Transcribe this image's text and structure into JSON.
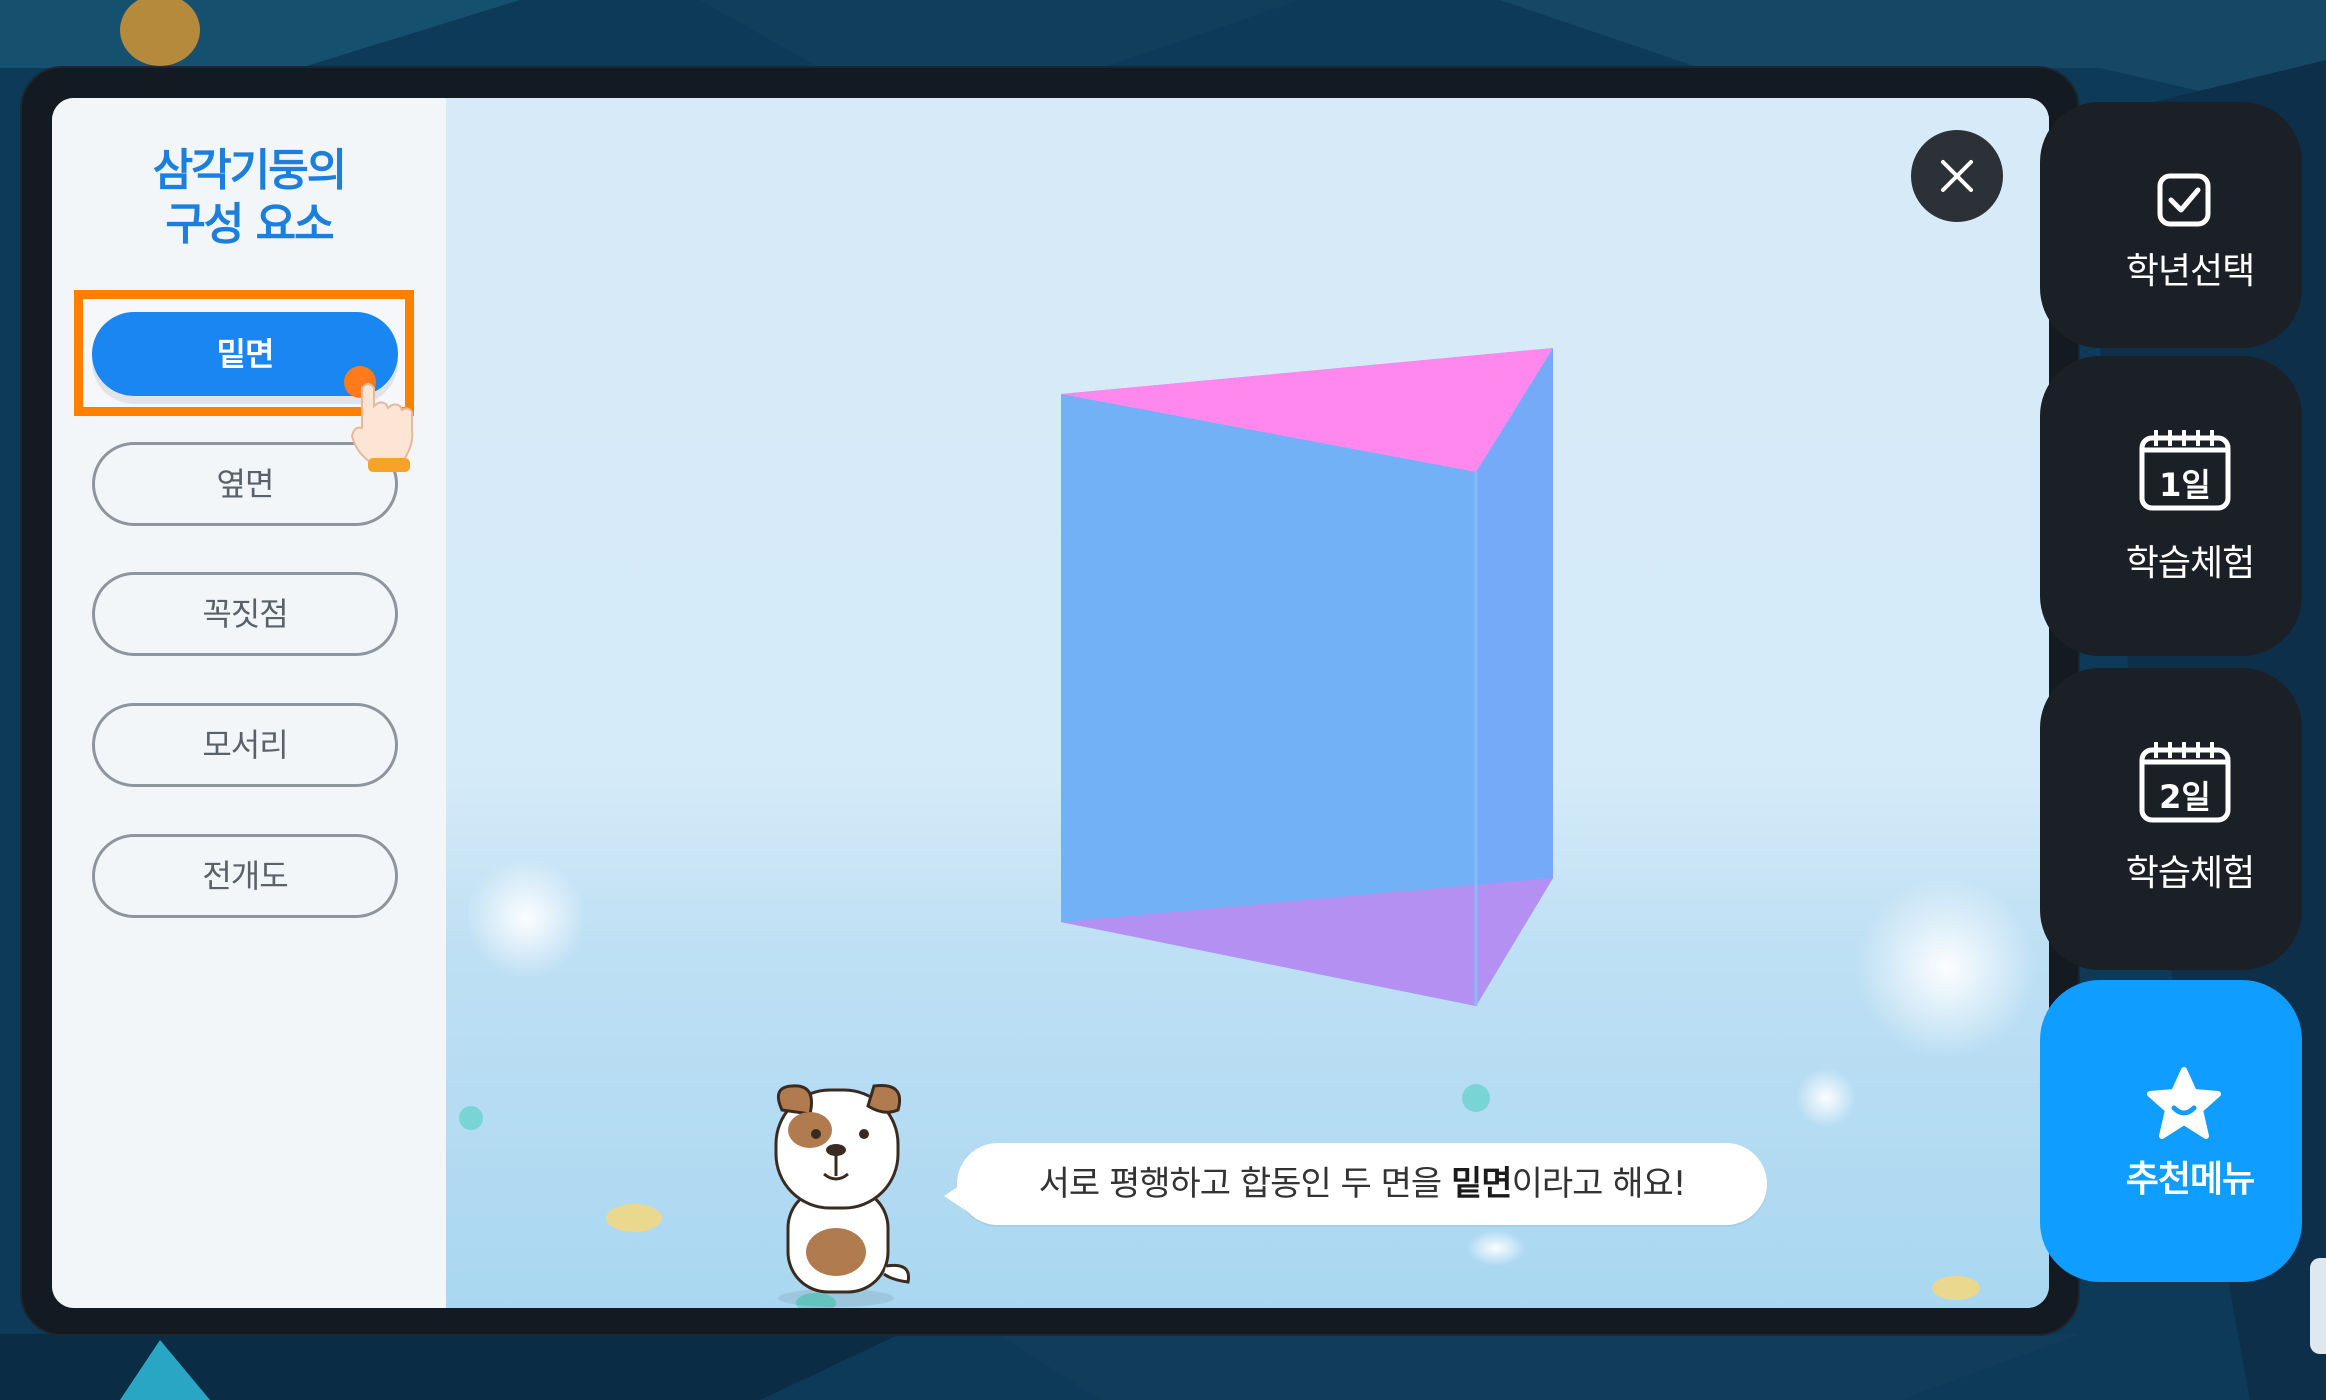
{
  "panel": {
    "title_line1": "삼각기둥의",
    "title_line2": "구성 요소",
    "menu": [
      {
        "label": "밑면",
        "active": true
      },
      {
        "label": "옆면",
        "active": false
      },
      {
        "label": "꼭짓점",
        "active": false
      },
      {
        "label": "모서리",
        "active": false
      },
      {
        "label": "전개도",
        "active": false
      }
    ]
  },
  "tool_tabs": [
    {
      "icon": "image-icon",
      "active": false
    },
    {
      "icon": "shapes-icon",
      "active": true
    }
  ],
  "speech": {
    "prefix": "서로 평행하고 합동인 두 면을 ",
    "bold": "밑면",
    "suffix": "이라고 해요!"
  },
  "rail": [
    {
      "icon": "checkbox-icon",
      "label": "학년선택"
    },
    {
      "icon": "calendar-icon",
      "icon_text": "1일",
      "label": "학습체험"
    },
    {
      "icon": "calendar-icon",
      "icon_text": "2일",
      "label": "학습체험"
    },
    {
      "icon": "star-icon",
      "label": "추천메뉴"
    }
  ],
  "colors": {
    "accent_blue": "#1a86f2",
    "highlight_orange": "#ff7f00",
    "title_blue": "#1d7fdc",
    "prism_top_face": "#ff88ee",
    "prism_bottom_face": "#b490f2",
    "prism_side": "#6eaef6"
  }
}
